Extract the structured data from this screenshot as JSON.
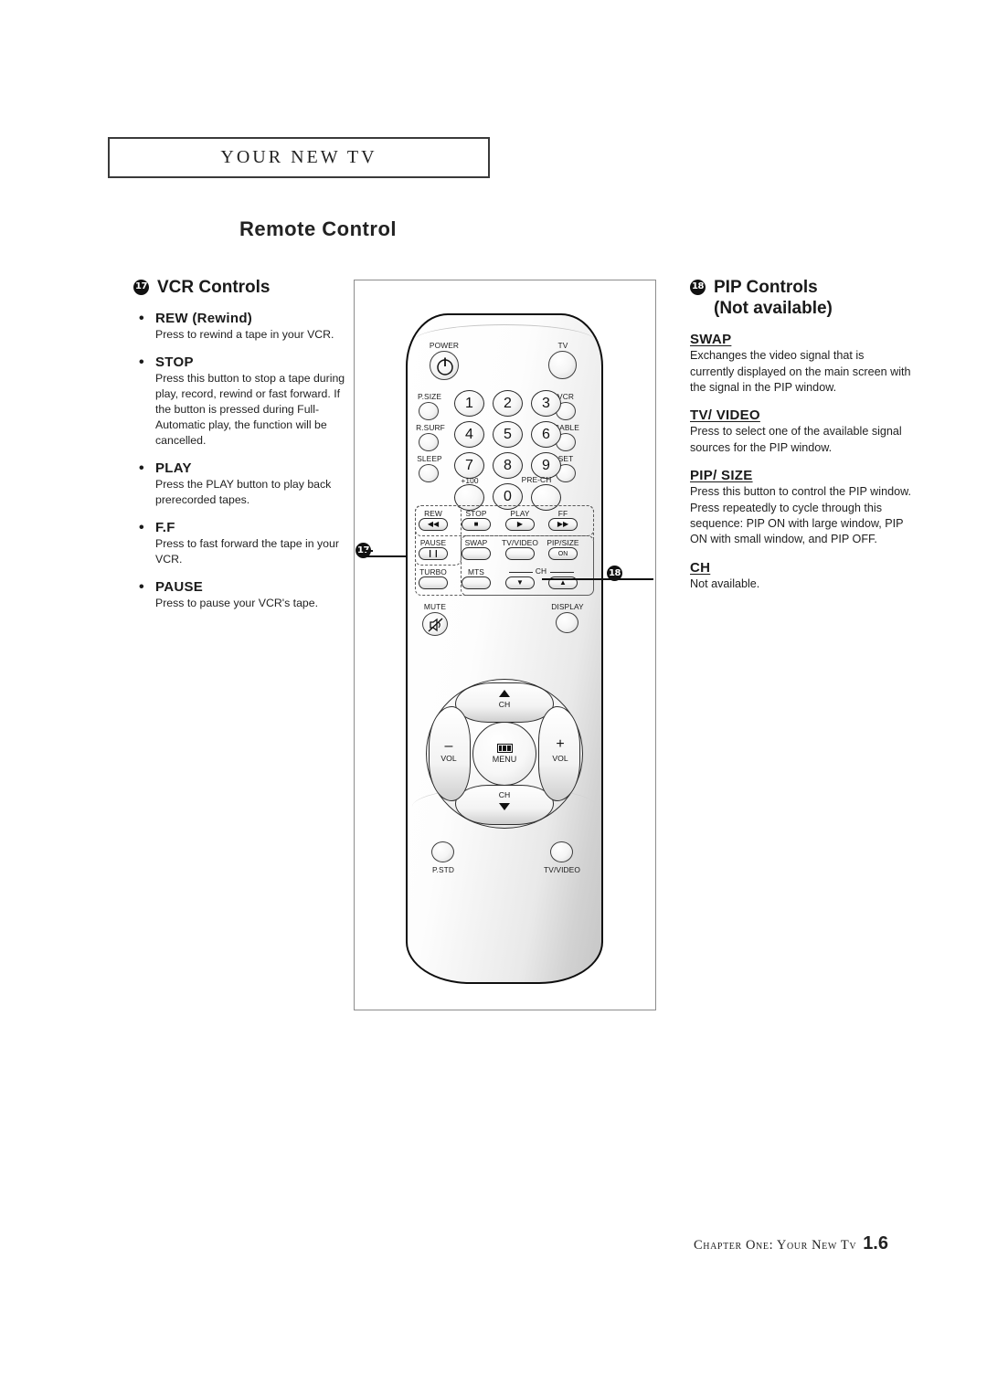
{
  "page": {
    "chapter_header": "Your New Tv",
    "section_title": "Remote Control",
    "footer_text": "Chapter One: Your New Tv",
    "footer_page": "1.6"
  },
  "left_column": {
    "badge": "17",
    "heading": "VCR Controls",
    "entries": [
      {
        "term": "REW (Rewind)",
        "desc": "Press to rewind a tape in your VCR."
      },
      {
        "term": "STOP",
        "desc": "Press this button to stop a tape during play, record, rewind or fast forward. If the button is pressed during Full-Automatic play, the function will be cancelled."
      },
      {
        "term": "PLAY",
        "desc": "Press the PLAY button to play back prerecorded tapes."
      },
      {
        "term": "F.F",
        "desc": "Press to fast forward the tape in your VCR."
      },
      {
        "term": "PAUSE",
        "desc": "Press to pause your VCR's tape."
      }
    ]
  },
  "right_column": {
    "badge": "18",
    "heading_line1": "PIP Controls",
    "heading_line2": "(Not available)",
    "entries": [
      {
        "term": "SWAP",
        "desc": "Exchanges the video signal that is currently displayed on the main screen with the signal in the PIP window."
      },
      {
        "term": "TV/ VIDEO",
        "desc": "Press to select one of the available signal sources for the PIP window."
      },
      {
        "term": "PIP/ SIZE",
        "desc": "Press this button to control the PIP window. Press repeatedly to cycle through this sequence: PIP ON with large window, PIP ON with small window, and PIP OFF."
      },
      {
        "term": "CH",
        "desc": "Not available."
      }
    ]
  },
  "figure": {
    "callouts": [
      {
        "id": "17",
        "target": "vcr-control-group"
      },
      {
        "id": "18",
        "target": "pip-control-group"
      }
    ],
    "remote": {
      "top_row": {
        "power": "POWER",
        "tv": "TV"
      },
      "left_side": [
        "P.SIZE",
        "R.SURF",
        "SLEEP"
      ],
      "right_side": [
        "VCR",
        "CABLE",
        "SET"
      ],
      "keypad": [
        "1",
        "2",
        "3",
        "4",
        "5",
        "6",
        "7",
        "8",
        "9",
        "0"
      ],
      "keypad_extra": {
        "plus100": "+100",
        "prech": "PRE-CH"
      },
      "vcr_row": [
        {
          "label": "REW",
          "glyph": "◀◀"
        },
        {
          "label": "STOP",
          "glyph": "■"
        },
        {
          "label": "PLAY",
          "glyph": "▶"
        },
        {
          "label": "FF",
          "glyph": "▶▶"
        }
      ],
      "mid_row": [
        {
          "label": "PAUSE",
          "glyph": "❙❙"
        },
        {
          "label": "SWAP",
          "glyph": ""
        },
        {
          "label": "TV/VIDEO",
          "glyph": ""
        },
        {
          "label": "PIP/SIZE",
          "glyph": "ON"
        }
      ],
      "low_row": [
        {
          "label": "TURBO",
          "glyph": ""
        },
        {
          "label": "MTS",
          "glyph": ""
        },
        {
          "label": "CH",
          "glyph": "▼"
        },
        {
          "label": "CH",
          "glyph": "▲"
        }
      ],
      "ch_group_label": "CH",
      "mute": "MUTE",
      "display": "DISPLAY",
      "nav": {
        "up": "CH",
        "down": "CH",
        "left": "VOL",
        "right": "VOL",
        "left_sym": "–",
        "right_sym": "+",
        "center": "MENU"
      },
      "bottom": {
        "pstd": "P.STD",
        "tvvideo": "TV/VIDEO"
      }
    }
  }
}
